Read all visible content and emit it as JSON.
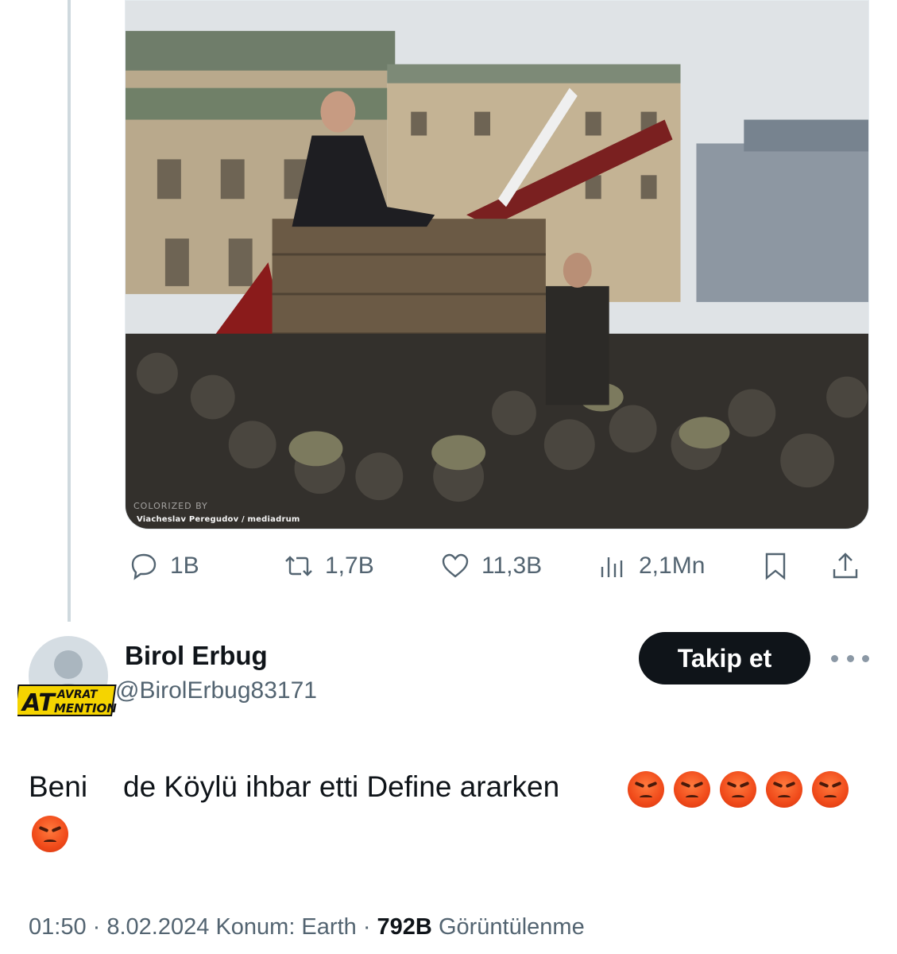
{
  "media": {
    "alt": "",
    "watermark": "COLORIZED BY",
    "credit": "Viacheslav Peregudov / mediadrum"
  },
  "actions": {
    "replies": "1B",
    "retweets": "1,7B",
    "likes": "11,3B",
    "views": "2,1Mn"
  },
  "reply": {
    "name": "Birol Erbug",
    "handle": "@BirolErbug83171",
    "follow_label": "Takip et",
    "sticker_top": "AVRAT",
    "sticker_left": "AT",
    "sticker_bottom": "MENTION",
    "text_part1": "Beni",
    "text_part2": "de Köylü ihbar etti Define ararken",
    "emoji_count": 6,
    "emoji_name": "angry-face",
    "time": "01:50",
    "date": "8.02.2024",
    "location": "Konum: Earth",
    "views_count": "792B",
    "views_label": "Görüntülenme"
  },
  "colors": {
    "text_primary": "#0f1419",
    "text_secondary": "#536471",
    "button_bg": "#0f1419",
    "thread_line": "#cfd9de"
  }
}
